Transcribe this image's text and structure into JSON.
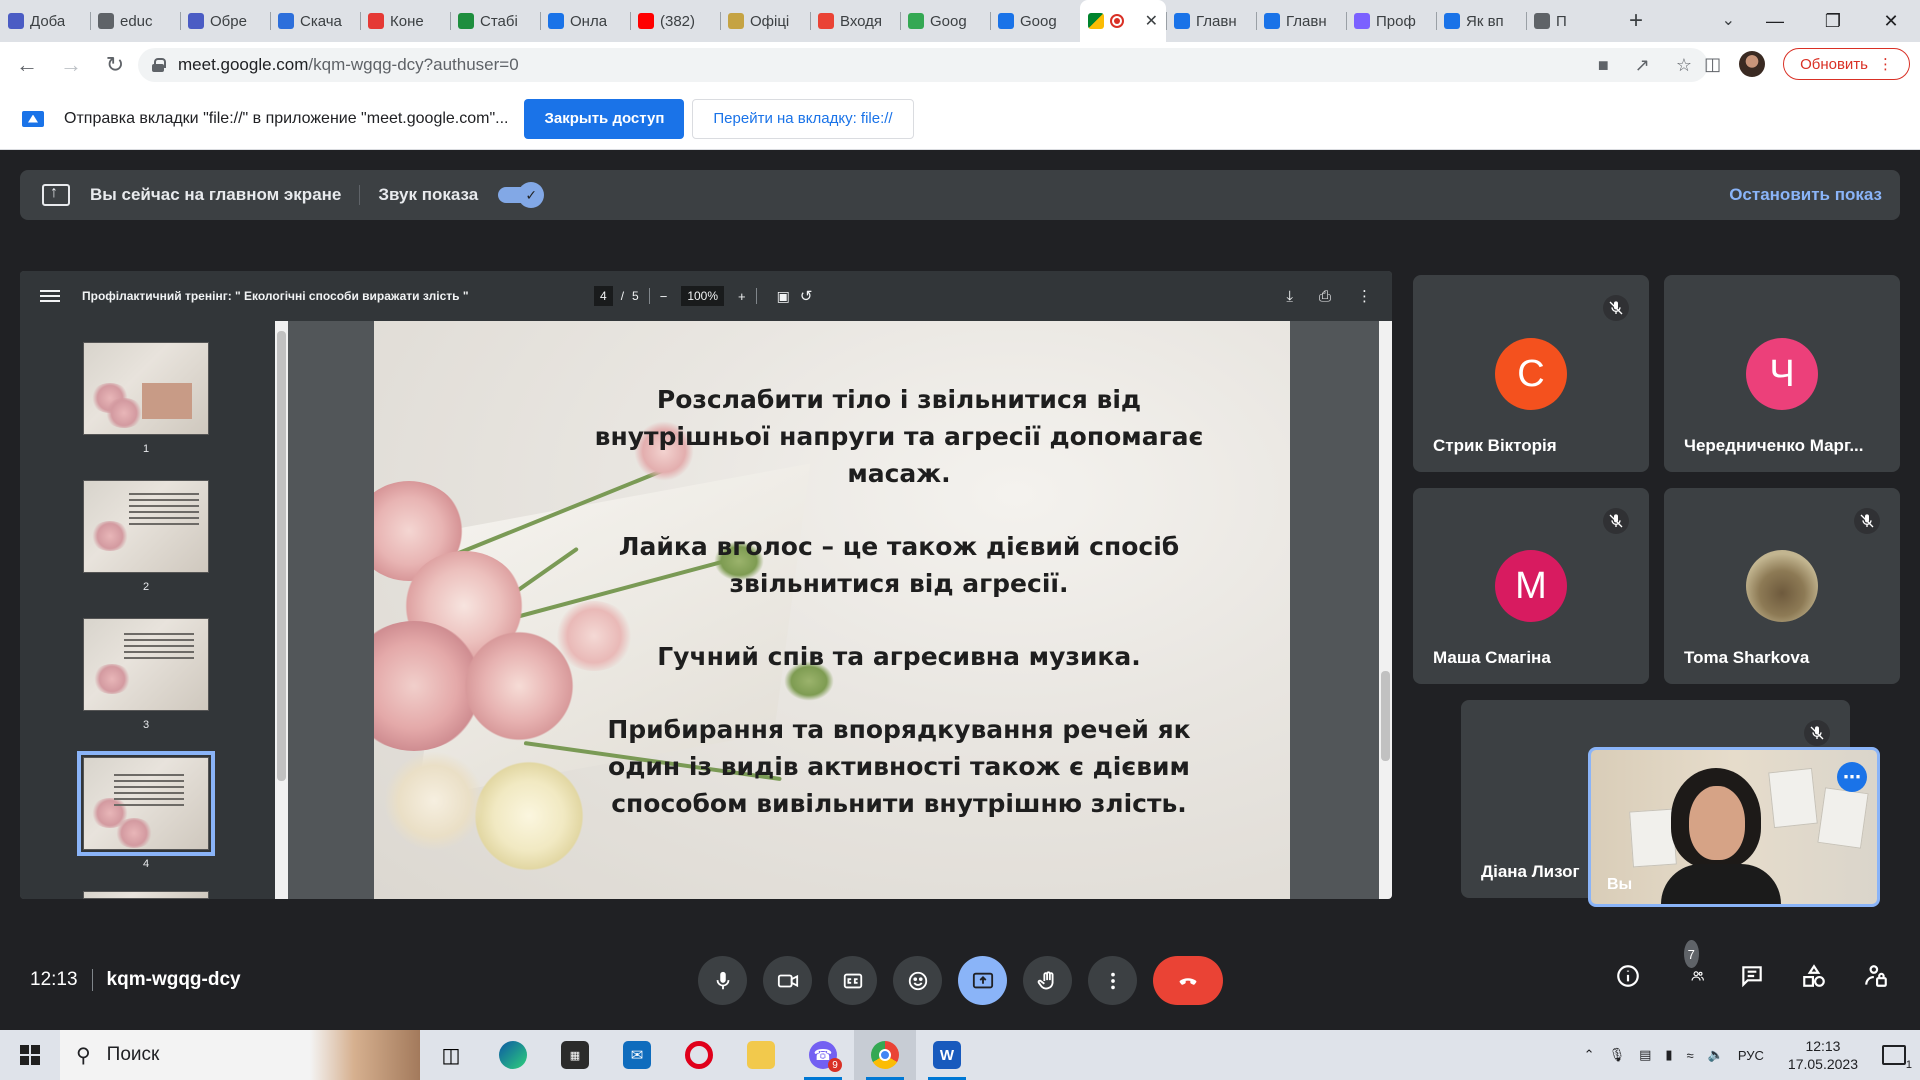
{
  "browser": {
    "tabs": [
      {
        "title": "Доба",
        "color": "#4b5cc4"
      },
      {
        "title": "educ",
        "color": "#5f6368"
      },
      {
        "title": "Обре",
        "color": "#4b5cc4"
      },
      {
        "title": "Скача",
        "color": "#2d6fdb"
      },
      {
        "title": "Коне",
        "color": "#e53935"
      },
      {
        "title": "Стабі",
        "color": "#1e8e3e"
      },
      {
        "title": "Онла",
        "color": "#1a73e8"
      },
      {
        "title": "(382)",
        "color": "#ff0000"
      },
      {
        "title": "Офіці",
        "color": "#c5a343"
      },
      {
        "title": "Входя",
        "color": "#ea4335"
      },
      {
        "title": "Goog",
        "color": "#34a853"
      },
      {
        "title": "Goog",
        "color": "#1a73e8"
      },
      {
        "title": "Главн",
        "color": "#1a73e8"
      },
      {
        "title": "Главн",
        "color": "#1a73e8"
      },
      {
        "title": "Проф",
        "color": "#7b61ff"
      },
      {
        "title": "Як вп",
        "color": "#1a73e8"
      },
      {
        "title": "П",
        "color": "#5f6368"
      }
    ],
    "url_host": "meet.google.com",
    "url_path": "/kqm-wgqg-dcy?authuser=0",
    "update_label": "Обновить"
  },
  "infobar": {
    "text": "Отправка вкладки \"file://\" в приложение \"meet.google.com\"...",
    "close_access": "Закрыть доступ",
    "goto_tab": "Перейти на вкладку: file://"
  },
  "presenting": {
    "message": "Вы сейчас на главном экране",
    "audio_label": "Звук показа",
    "audio_on": true,
    "stop_label": "Остановить показ"
  },
  "pdf": {
    "title": "Профілактичний тренінг: \" Екологічні способи виражати злість \"",
    "current_page": "4",
    "total_pages": "5",
    "zoom": "100%",
    "thumbnails": [
      {
        "label": "1"
      },
      {
        "label": "2"
      },
      {
        "label": "3"
      },
      {
        "label": "4"
      }
    ],
    "slide": {
      "p1": "Розслабити тіло і звільнитися від внутрішньої напруги та агресії допомагає масаж.",
      "p2": "Лайка вголос – це також дієвий спосіб звільнитися від агресії.",
      "p3": "Гучний спів та агресивна музика.",
      "p4": "Прибирання та впорядкування речей як один із видів активності також є дієвим способом вивільнити внутрішню злість."
    }
  },
  "participants": [
    {
      "name": "Стрик Вікторія",
      "initial": "С",
      "color": "#f4511e"
    },
    {
      "name": "Чередниченко Марг...",
      "initial": "Ч",
      "color": "#ec407a"
    },
    {
      "name": "Маша Смагіна",
      "initial": "М",
      "color": "#d81b60"
    },
    {
      "name": "Toma Sharkova",
      "initial": "",
      "color": "#7a6a4a"
    },
    {
      "name": "Діана Лизог",
      "initial": "",
      "color": "#5f6368"
    }
  ],
  "self_view": {
    "label": "Вы"
  },
  "meeting": {
    "time": "12:13",
    "code": "kqm-wgqg-dcy",
    "people_count": "7"
  },
  "taskbar": {
    "search_label": "Поиск",
    "lang": "РУС",
    "time": "12:13",
    "date": "17.05.2023",
    "notifications": "1",
    "viber_badge": "9"
  }
}
